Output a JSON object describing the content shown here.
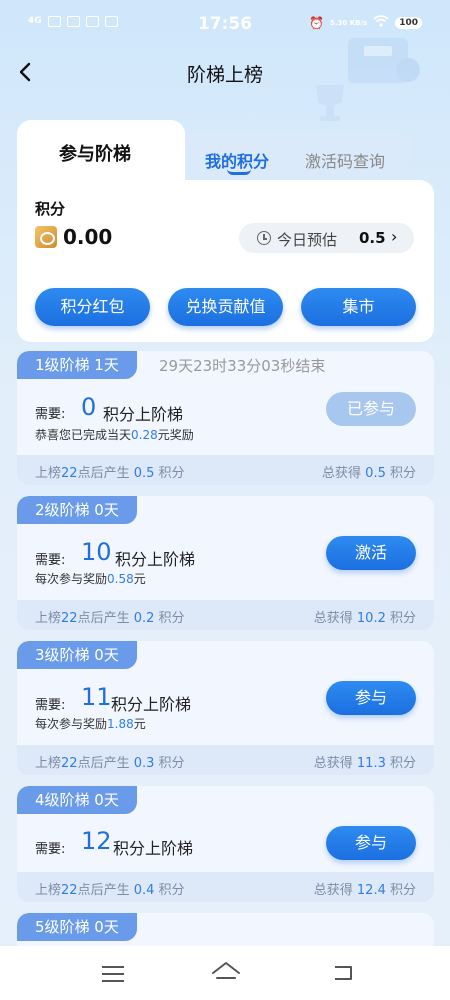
{
  "status_bar": {
    "signal": "4G",
    "time": "17:56",
    "speed": "5.30 KB/s",
    "battery": "100"
  },
  "header": {
    "title": "阶梯上榜"
  },
  "top_card": {
    "tabs": {
      "main": "参与阶梯",
      "mine": "我的积分",
      "code": "激活码查询"
    },
    "points_label": "积分",
    "points_value": "0.00",
    "estimate_label": "今日预估",
    "estimate_value": "0.5",
    "buttons": [
      "积分红包",
      "兑换贡献值",
      "集市"
    ]
  },
  "tiers": [
    {
      "badge": "1级阶梯  1天",
      "countdown": "29天23时33分03秒结束",
      "need_label": "需要:",
      "need_num": "0",
      "need_unit": "积分上阶梯",
      "note_pre": "恭喜您已完成当天",
      "note_hl": "0.28",
      "note_post": "元奖励",
      "button": "已参与",
      "footer_left_pre": "上榜",
      "footer_left_hour": "22",
      "footer_left_mid": "点后产生 ",
      "footer_left_val": "0.5",
      "footer_left_unit": " 积分",
      "footer_right_pre": "总获得 ",
      "footer_right_val": "0.5",
      "footer_right_unit": " 积分"
    },
    {
      "badge": "2级阶梯  0天",
      "need_label": "需要:",
      "need_num": "10",
      "need_unit": "积分上阶梯",
      "note_pre": "每次参与奖励",
      "note_hl": "0.58",
      "note_post": "元",
      "button": "激活",
      "footer_left_pre": "上榜",
      "footer_left_hour": "22",
      "footer_left_mid": "点后产生 ",
      "footer_left_val": "0.2",
      "footer_left_unit": " 积分",
      "footer_right_pre": "总获得 ",
      "footer_right_val": "10.2",
      "footer_right_unit": " 积分"
    },
    {
      "badge": "3级阶梯  0天",
      "need_label": "需要:",
      "need_num": "11",
      "need_unit": "积分上阶梯",
      "note_pre": "每次参与奖励",
      "note_hl": "1.88",
      "note_post": "元",
      "button": "参与",
      "footer_left_pre": "上榜",
      "footer_left_hour": "22",
      "footer_left_mid": "点后产生 ",
      "footer_left_val": "0.3",
      "footer_left_unit": " 积分",
      "footer_right_pre": "总获得 ",
      "footer_right_val": "11.3",
      "footer_right_unit": " 积分"
    },
    {
      "badge": "4级阶梯  0天",
      "need_label": "需要:",
      "need_num": "12",
      "need_unit": "积分上阶梯",
      "button": "参与",
      "footer_left_pre": "上榜",
      "footer_left_hour": "22",
      "footer_left_mid": "点后产生 ",
      "footer_left_val": "0.4",
      "footer_left_unit": " 积分",
      "footer_right_pre": "总获得 ",
      "footer_right_val": "12.4",
      "footer_right_unit": " 积分"
    },
    {
      "badge": "5级阶梯  0天"
    }
  ],
  "icons": {
    "back": "back-arrow-icon",
    "clock": "clock-icon",
    "coin": "coin-icon",
    "trophy": "trophy-icon"
  },
  "colors": {
    "accent": "#1f6fe0",
    "badge": "#6a9bea",
    "disabled": "#a8c7ee"
  }
}
